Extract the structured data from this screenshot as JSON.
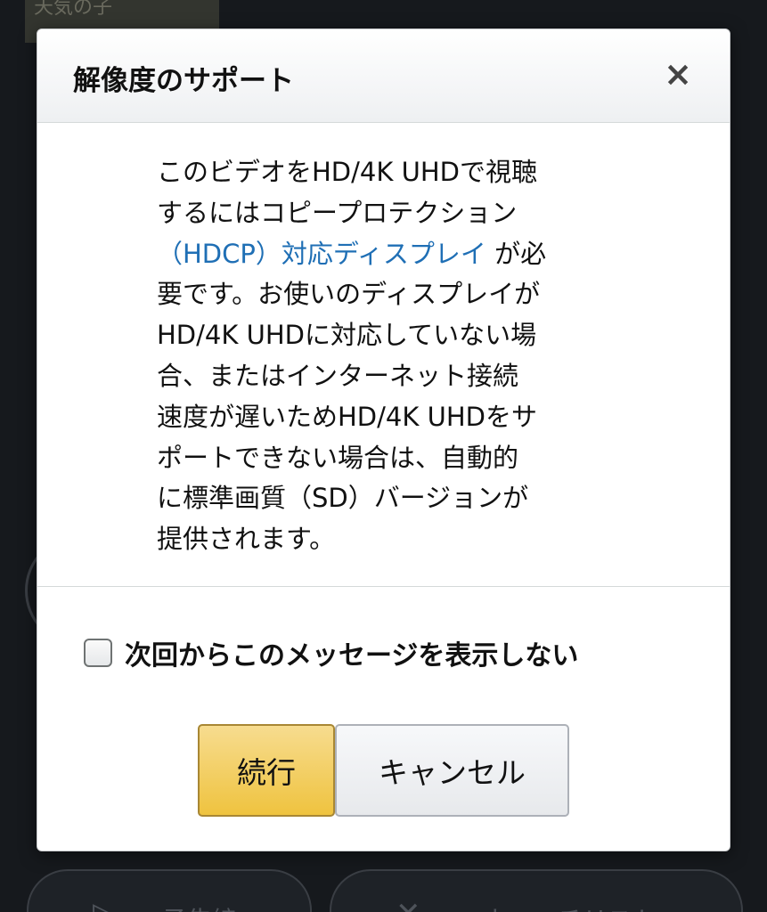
{
  "background": {
    "thumb_text": "天気の子",
    "trailer_label": "予告編",
    "watchlist_label": "ウォッチリスト"
  },
  "dialog": {
    "title": "解像度のサポート",
    "close_label": "×",
    "body": {
      "line1": "このビデオをHD/4K UHDで視聴",
      "line2": "するにはコピープロテクション",
      "link_text": "（HDCP）対応ディスプレイ",
      "line3_suffix": " が必",
      "line4": "要です。お使いのディスプレイが",
      "line5": "HD/4K UHDに対応していない場",
      "line6": "合、またはインターネット接続",
      "line7": "速度が遅いためHD/4K UHDをサ",
      "line8": "ポートできない場合は、自動的",
      "line9": "に標準画質（SD）バージョンが",
      "line10": "提供されます。"
    },
    "checkbox": {
      "label": "次回からこのメッセージを表示しない",
      "checked": false
    },
    "buttons": {
      "continue_label": "続行",
      "cancel_label": "キャンセル"
    }
  },
  "colors": {
    "link": "#1f6fb5",
    "primary_button": "#efc33f",
    "backdrop": "#16191d"
  }
}
